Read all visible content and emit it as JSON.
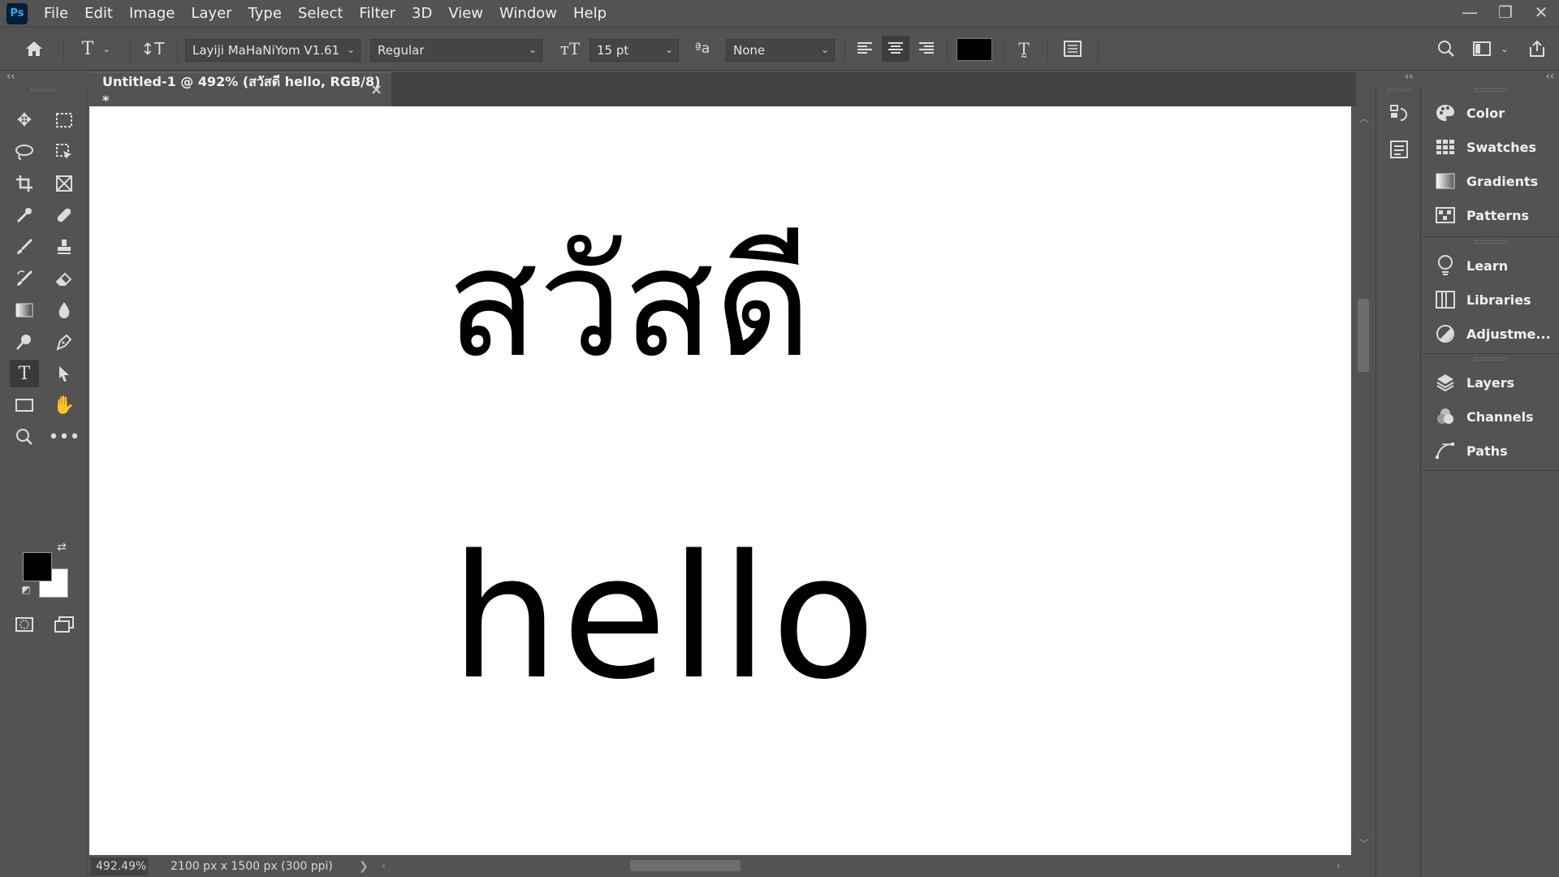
{
  "app": {
    "logo_text": "Ps"
  },
  "menu": [
    "File",
    "Edit",
    "Image",
    "Layer",
    "Type",
    "Select",
    "Filter",
    "3D",
    "View",
    "Window",
    "Help"
  ],
  "window_controls": {
    "minimize": "—",
    "restore": "❐",
    "close": "✕"
  },
  "options_bar": {
    "font_family": "Layiji MaHaNiYom V1.61",
    "font_style": "Regular",
    "font_size": "15 pt",
    "aa_label": "ªa",
    "antialias": "None",
    "text_color": "#000000"
  },
  "document": {
    "tab_title": "Untitled-1 @ 492% (สวัสดี hello, RGB/8) *",
    "canvas_lines": [
      "สวัสดี",
      "hello"
    ]
  },
  "status": {
    "zoom": "492.49%",
    "doc_info": "2100 px x 1500 px (300 ppi)",
    "arrow": "❯"
  },
  "colors": {
    "foreground": "#000000",
    "background": "#ffffff",
    "ui_bg": "#535353"
  },
  "panels": {
    "group1": [
      {
        "label": "Color",
        "icon": "palette-icon"
      },
      {
        "label": "Swatches",
        "icon": "swatches-icon"
      },
      {
        "label": "Gradients",
        "icon": "gradients-icon"
      },
      {
        "label": "Patterns",
        "icon": "patterns-icon"
      }
    ],
    "group2": [
      {
        "label": "Learn",
        "icon": "lightbulb-icon"
      },
      {
        "label": "Libraries",
        "icon": "libraries-icon"
      },
      {
        "label": "Adjustme...",
        "icon": "adjustments-icon"
      }
    ],
    "group3": [
      {
        "label": "Layers",
        "icon": "layers-icon"
      },
      {
        "label": "Channels",
        "icon": "channels-icon"
      },
      {
        "label": "Paths",
        "icon": "paths-icon"
      }
    ]
  }
}
